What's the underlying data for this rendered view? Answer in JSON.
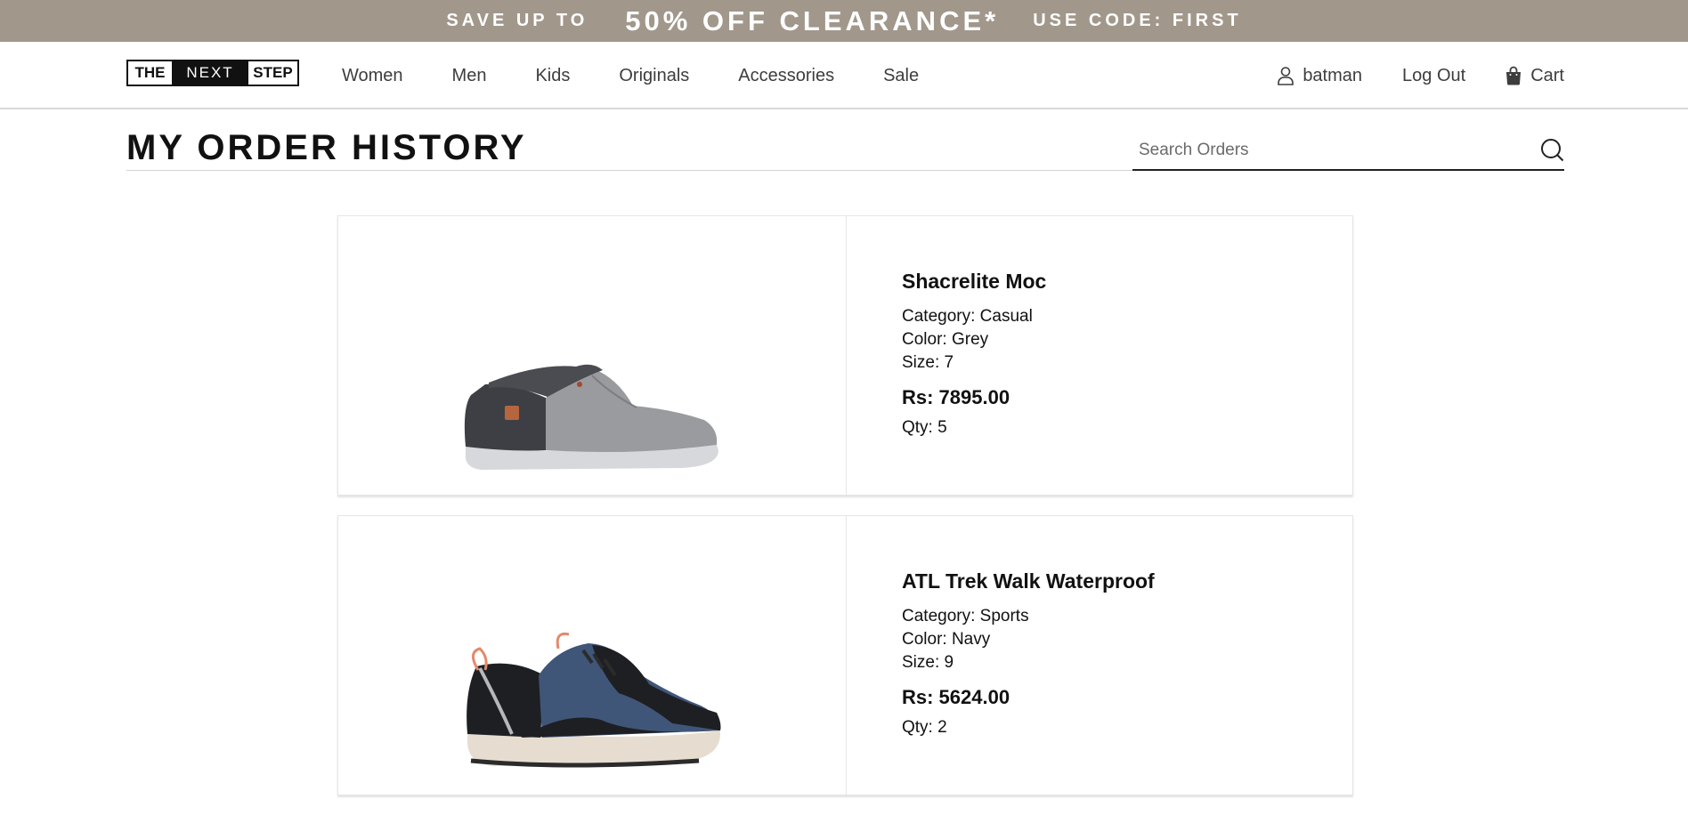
{
  "promo": {
    "left": "SAVE UP TO",
    "center": "50% OFF CLEARANCE*",
    "right": "USE CODE: FIRST"
  },
  "logo": {
    "part1": "THE",
    "part2": "NEXT",
    "part3": "STEP"
  },
  "nav": {
    "items": [
      {
        "label": "Women"
      },
      {
        "label": "Men"
      },
      {
        "label": "Kids"
      },
      {
        "label": "Originals"
      },
      {
        "label": "Accessories"
      },
      {
        "label": "Sale"
      }
    ]
  },
  "user": {
    "username": "batman",
    "logout": "Log Out",
    "cart": "Cart"
  },
  "page": {
    "title": "MY ORDER HISTORY"
  },
  "search": {
    "placeholder": "Search Orders"
  },
  "orders": [
    {
      "name": "Shacrelite Moc",
      "category": "Category: Casual",
      "color": "Color: Grey",
      "size": "Size: 7",
      "price": "Rs: 7895.00",
      "qty": "Qty: 5"
    },
    {
      "name": "ATL Trek Walk Waterproof",
      "category": "Category: Sports",
      "color": "Color: Navy",
      "size": "Size: 9",
      "price": "Rs: 5624.00",
      "qty": "Qty: 2"
    }
  ],
  "icons": {
    "user": "user-icon",
    "cart": "shopping-bag-icon",
    "search": "search-icon"
  },
  "colors": {
    "promo_bg": "#a1978b"
  }
}
